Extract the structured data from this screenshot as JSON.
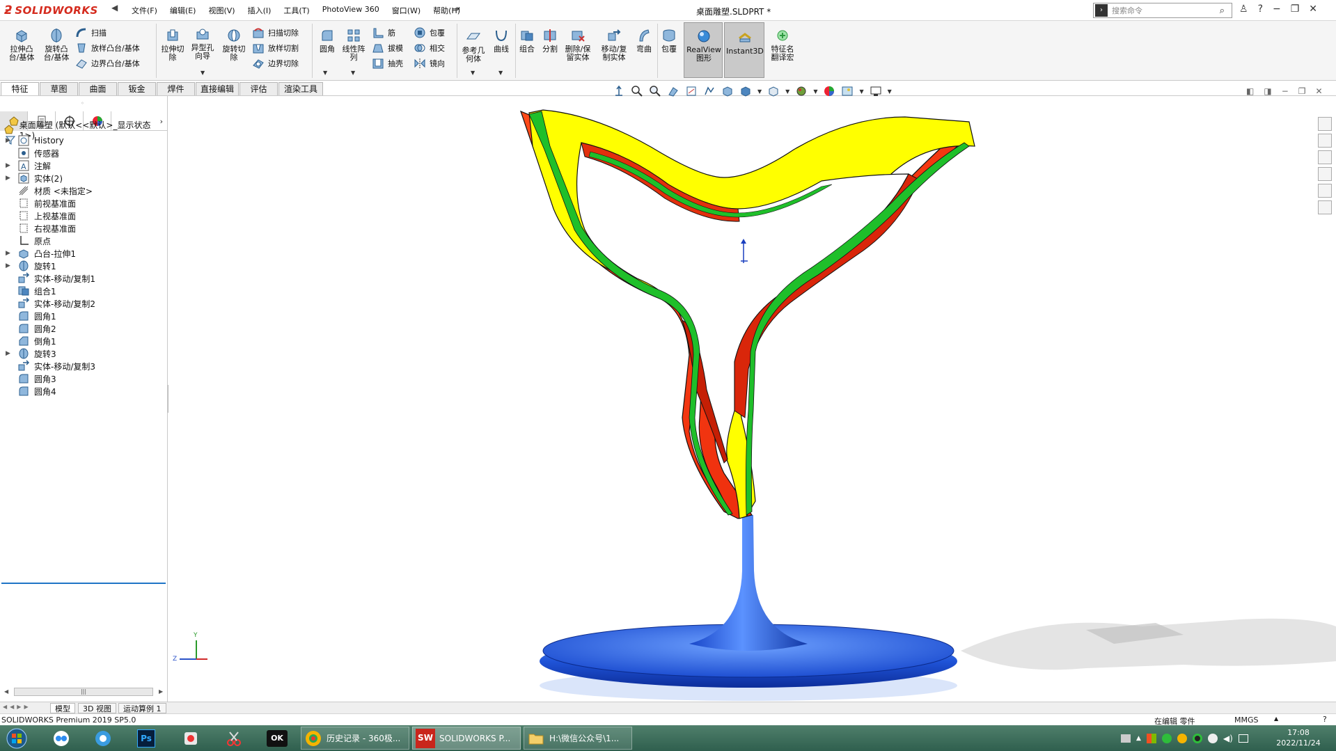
{
  "app": {
    "logo_text_solid": "SOLID",
    "logo_text_works": "WORKS",
    "document_title": "桌面雕塑.SLDPRT *",
    "menu": [
      "文件(F)",
      "编辑(E)",
      "视图(V)",
      "插入(I)",
      "工具(T)",
      "PhotoView 360",
      "窗口(W)",
      "帮助(H)"
    ],
    "search_placeholder": "搜索命令"
  },
  "ribbon": {
    "extrude_boss": "拉伸凸\n台/基体",
    "revolve_boss": "旋转凸\n台/基体",
    "sweep": "扫描",
    "loft_boss": "放样凸台/基体",
    "boundary_boss": "边界凸台/基体",
    "extrude_cut": "拉伸切\n除",
    "hole_wizard": "异型孔\n向导",
    "revolve_cut": "旋转切\n除",
    "swept_cut": "扫描切除",
    "lofted_cut": "放样切割",
    "boundary_cut": "边界切除",
    "fillet": "圆角",
    "linear_pattern": "线性阵\n列",
    "rib": "筋",
    "draft": "拔模",
    "shell": "抽壳",
    "wrap": "包覆",
    "intersect": "相交",
    "mirror": "镜向",
    "ref_geometry": "参考几\n何体",
    "curves": "曲线",
    "combine": "组合",
    "split": "分割",
    "delete_keep": "删除/保\n留实体",
    "move_copy": "移动/复\n制实体",
    "flex": "弯曲",
    "wrap2": "包覆",
    "realview": "RealView\n图形",
    "instant3d": "Instant3D",
    "feature_translate": "特征名\n翻译宏"
  },
  "tabs": [
    "特征",
    "草图",
    "曲面",
    "钣金",
    "焊件",
    "直接编辑",
    "评估",
    "渲染工具"
  ],
  "tree": {
    "root": "桌面雕塑  (默认<<默认>_显示状态 1>)",
    "items": [
      {
        "label": "History",
        "expand": true,
        "icon": "history-icon"
      },
      {
        "label": "传感器",
        "expand": false,
        "icon": "sensor-icon"
      },
      {
        "label": "注解",
        "expand": true,
        "icon": "annotation-icon"
      },
      {
        "label": "实体(2)",
        "expand": true,
        "icon": "solid-bodies-icon"
      },
      {
        "label": "材质 <未指定>",
        "expand": false,
        "icon": "material-icon"
      },
      {
        "label": "前视基准面",
        "expand": false,
        "icon": "plane-icon"
      },
      {
        "label": "上视基准面",
        "expand": false,
        "icon": "plane-icon"
      },
      {
        "label": "右视基准面",
        "expand": false,
        "icon": "plane-icon"
      },
      {
        "label": "原点",
        "expand": false,
        "icon": "origin-icon"
      },
      {
        "label": "凸台-拉伸1",
        "expand": true,
        "icon": "extrude-icon"
      },
      {
        "label": "旋转1",
        "expand": true,
        "icon": "revolve-icon"
      },
      {
        "label": "实体-移动/复制1",
        "expand": false,
        "icon": "move-copy-icon"
      },
      {
        "label": "组合1",
        "expand": false,
        "icon": "combine-icon"
      },
      {
        "label": "实体-移动/复制2",
        "expand": false,
        "icon": "move-copy-icon"
      },
      {
        "label": "圆角1",
        "expand": false,
        "icon": "fillet-icon"
      },
      {
        "label": "圆角2",
        "expand": false,
        "icon": "fillet-icon"
      },
      {
        "label": "倒角1",
        "expand": false,
        "icon": "chamfer-icon"
      },
      {
        "label": "旋转3",
        "expand": true,
        "icon": "revolve-icon"
      },
      {
        "label": "实体-移动/复制3",
        "expand": false,
        "icon": "move-copy-icon"
      },
      {
        "label": "圆角3",
        "expand": false,
        "icon": "fillet-icon"
      },
      {
        "label": "圆角4",
        "expand": false,
        "icon": "fillet-icon"
      }
    ]
  },
  "model_tabs": [
    "模型",
    "3D 视图",
    "运动算例 1"
  ],
  "status": {
    "left": "SOLIDWORKS Premium 2019 SP5.0",
    "editing": "在编辑 零件",
    "units": "MMGS"
  },
  "taskbar": {
    "tasks": [
      {
        "label": "历史记录 - 360极...",
        "icon": "browser360-icon"
      },
      {
        "label": "SOLIDWORKS P...",
        "icon": "solidworks-icon"
      },
      {
        "label": "H:\\微信公众号\\1...",
        "icon": "folder-icon"
      }
    ],
    "time": "17:08",
    "date": "2022/11/24"
  },
  "axis_labels": {
    "y": "Y",
    "z": "Z"
  },
  "colors": {
    "sculpture_red": "#ff3a10",
    "sculpture_yellow": "#ffff00",
    "sculpture_green": "#1fbf2a",
    "base_blue": "#1f5fe0"
  }
}
